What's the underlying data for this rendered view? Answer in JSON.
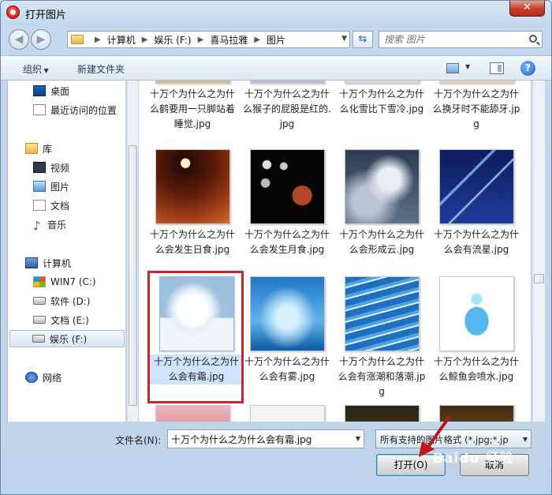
{
  "window": {
    "title": "打开图片",
    "close_glyph": "✕"
  },
  "address": {
    "crumbs": [
      "计算机",
      "娱乐 (F:)",
      "喜马拉雅",
      "图片"
    ],
    "search_placeholder": "搜索 图片"
  },
  "toolbar": {
    "organize_label": "组织",
    "new_folder_label": "新建文件夹",
    "help_glyph": "?"
  },
  "sidebar": {
    "items": [
      {
        "label": "桌面",
        "icon": "desktop-icon"
      },
      {
        "label": "最近访问的位置",
        "icon": "recent-places-icon"
      },
      {
        "label": "库",
        "icon": "library-icon"
      },
      {
        "label": "视频",
        "icon": "video-icon"
      },
      {
        "label": "图片",
        "icon": "pictures-icon"
      },
      {
        "label": "文档",
        "icon": "documents-icon"
      },
      {
        "label": "音乐",
        "icon": "music-icon"
      },
      {
        "label": "计算机",
        "icon": "computer-icon"
      },
      {
        "label": "WIN7 (C:)",
        "icon": "windows-drive-icon"
      },
      {
        "label": "软件 (D:)",
        "icon": "drive-icon"
      },
      {
        "label": "文档 (E:)",
        "icon": "drive-icon"
      },
      {
        "label": "娱乐 (F:)",
        "icon": "drive-icon",
        "selected": true
      },
      {
        "label": "网络",
        "icon": "network-icon"
      }
    ]
  },
  "files": [
    {
      "name": "十万个为什么之为什么鹤要用一只脚站着睡觉.jpg"
    },
    {
      "name": "十万个为什么之为什么猴子的屁股是红的.jpg"
    },
    {
      "name": "十万个为什么之为什么化雪比下雪冷.jpg"
    },
    {
      "name": "十万个为什么之为什么换牙时不能舔牙.jpg"
    },
    {
      "name": "十万个为什么之为什么会发生日食.jpg"
    },
    {
      "name": "十万个为什么之为什么会发生月食.jpg"
    },
    {
      "name": "十万个为什么之为什么会形成云.jpg"
    },
    {
      "name": "十万个为什么之为什么会有流星.jpg"
    },
    {
      "name": "十万个为什么之为什么会有霜.jpg",
      "selected": true
    },
    {
      "name": "十万个为什么之为什么会有雾.jpg"
    },
    {
      "name": "十万个为什么之为什么会有涨潮和落潮.jpg"
    },
    {
      "name": "十万个为什么之为什么鲸鱼会喷水.jpg"
    }
  ],
  "footer": {
    "filename_label": "文件名(N):",
    "filename_value": "十万个为什么之为什么会有霜.jpg",
    "filetype_value": "所有支持的图片格式 (*.jpg;*.jp",
    "open_label": "打开(O)",
    "cancel_label": "取消"
  },
  "watermark": "Baidu 经验",
  "colors": {
    "highlight_border": "#c9262b",
    "arrow": "#c0151b"
  }
}
